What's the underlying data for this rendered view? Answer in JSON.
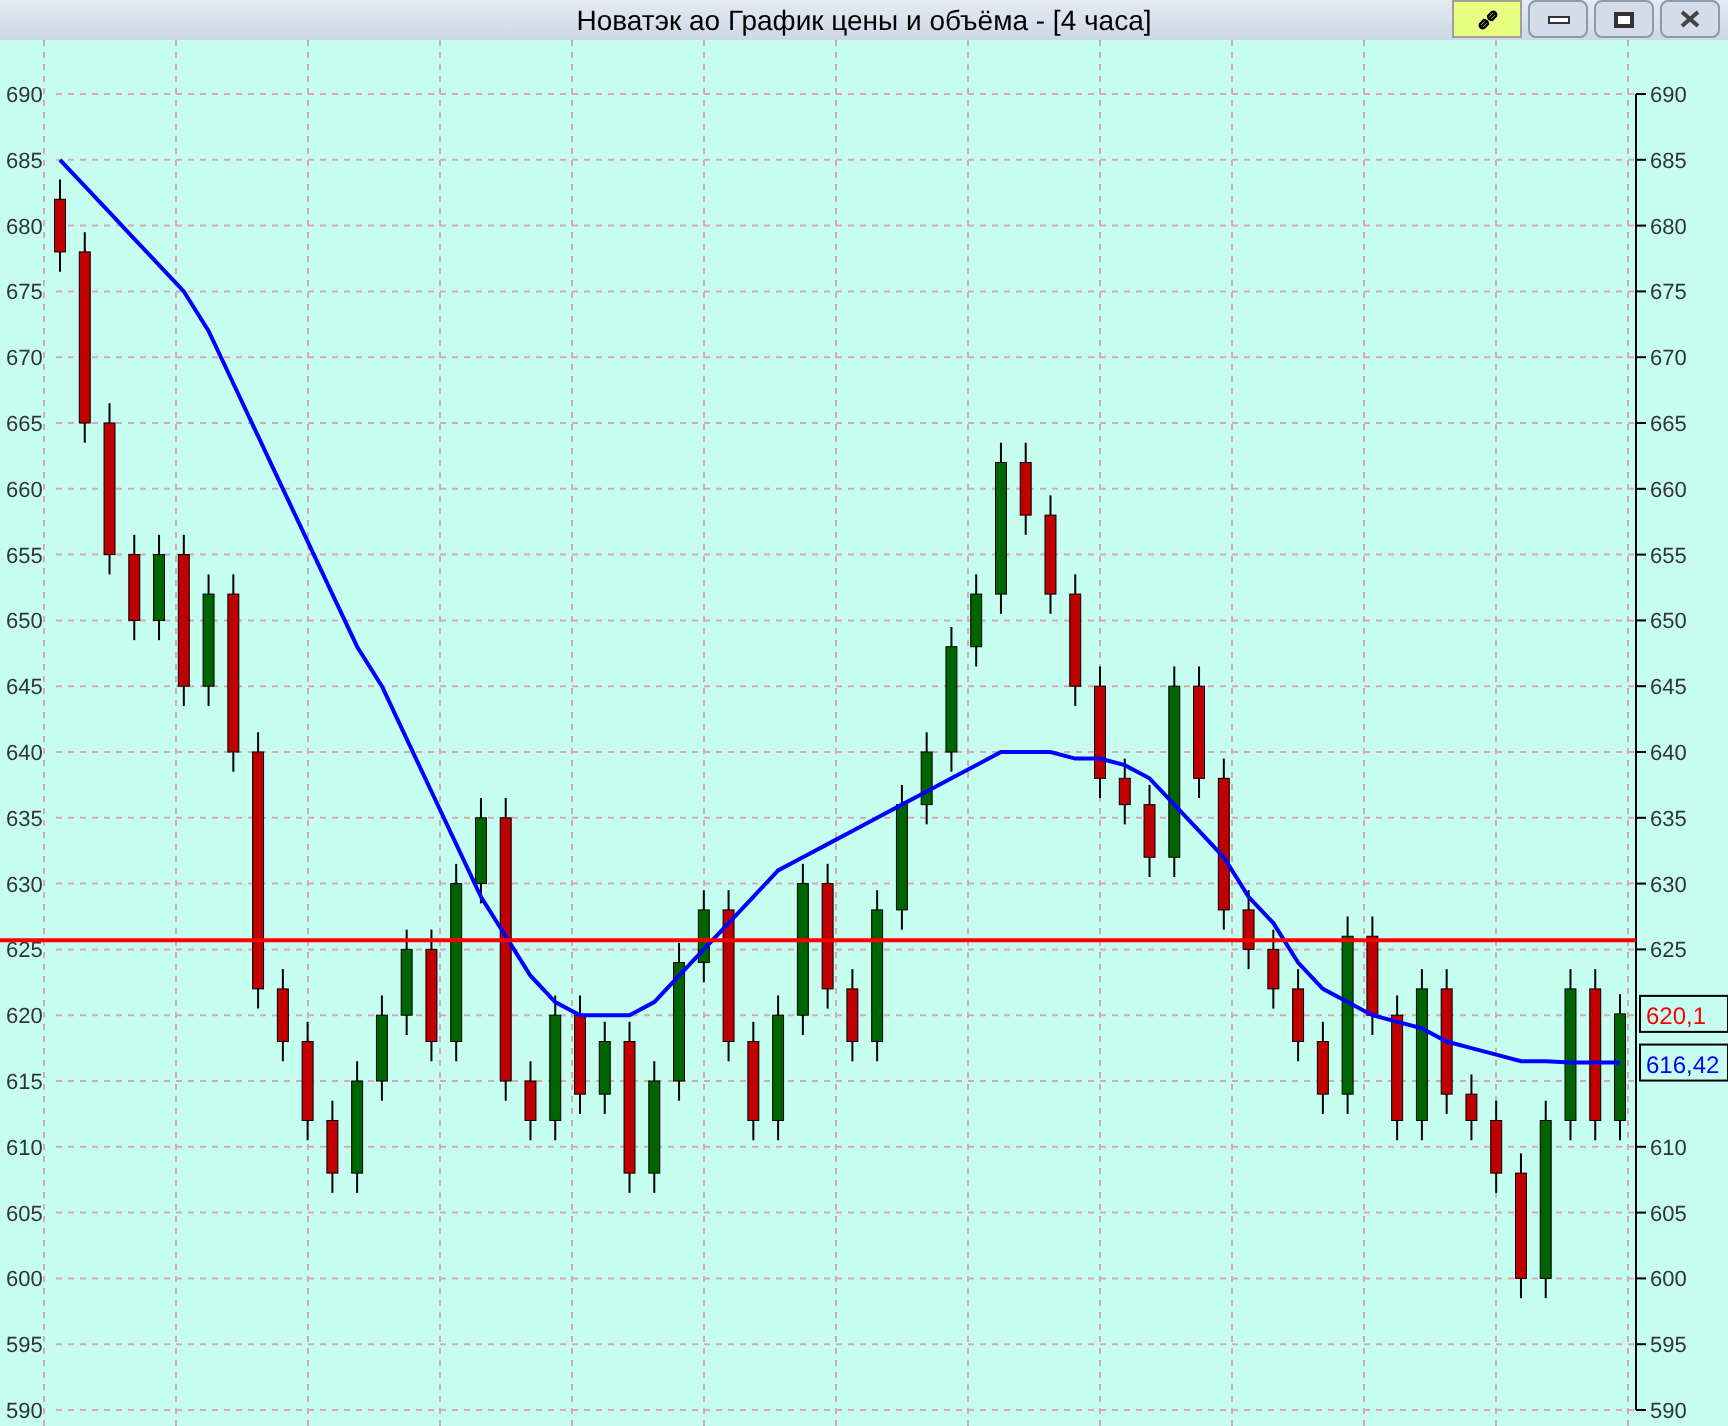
{
  "window": {
    "title": "Новатэк ао График цены и объёма - [4 часа]"
  },
  "chart": {
    "chart_data": {
      "type": "candlestick",
      "grid": true,
      "ylim": [
        590,
        690
      ],
      "yticks": [
        590,
        595,
        600,
        605,
        610,
        615,
        620,
        625,
        630,
        635,
        640,
        645,
        650,
        655,
        660,
        665,
        670,
        675,
        680,
        685,
        690
      ],
      "y2lim": [
        590,
        690
      ],
      "y2ticks": [
        590,
        595,
        600,
        605,
        610,
        625,
        630,
        635,
        640,
        645,
        650,
        655,
        660,
        665,
        670,
        675,
        680,
        685,
        690
      ],
      "ohlc": [
        [
          682,
          683.5,
          676.5,
          678
        ],
        [
          678,
          679.5,
          663.5,
          665
        ],
        [
          665,
          666.5,
          653.5,
          655
        ],
        [
          655,
          656.5,
          648.5,
          650
        ],
        [
          650,
          656.5,
          648.5,
          655
        ],
        [
          655,
          656.5,
          643.5,
          645
        ],
        [
          645,
          653.5,
          643.5,
          652
        ],
        [
          652,
          653.5,
          638.5,
          640
        ],
        [
          640,
          641.5,
          620.5,
          622
        ],
        [
          622,
          623.5,
          616.5,
          618
        ],
        [
          618,
          619.5,
          610.5,
          612
        ],
        [
          612,
          613.5,
          606.5,
          608
        ],
        [
          608,
          616.5,
          606.5,
          615
        ],
        [
          615,
          621.5,
          613.5,
          620
        ],
        [
          620,
          626.5,
          618.5,
          625
        ],
        [
          625,
          626.5,
          616.5,
          618
        ],
        [
          618,
          631.5,
          616.5,
          630
        ],
        [
          630,
          636.5,
          628.5,
          635
        ],
        [
          635,
          636.5,
          613.5,
          615
        ],
        [
          615,
          616.5,
          610.5,
          612
        ],
        [
          612,
          621.5,
          610.5,
          620
        ],
        [
          620,
          621.5,
          612.5,
          614
        ],
        [
          614,
          619.5,
          612.5,
          618
        ],
        [
          618,
          619.5,
          606.5,
          608
        ],
        [
          608,
          616.5,
          606.5,
          615
        ],
        [
          615,
          625.5,
          613.5,
          624
        ],
        [
          624,
          629.5,
          622.5,
          628
        ],
        [
          628,
          629.5,
          616.5,
          618
        ],
        [
          618,
          619.5,
          610.5,
          612
        ],
        [
          612,
          621.5,
          610.5,
          620
        ],
        [
          620,
          631.5,
          618.5,
          630
        ],
        [
          630,
          631.5,
          620.5,
          622
        ],
        [
          622,
          623.5,
          616.5,
          618
        ],
        [
          618,
          629.5,
          616.5,
          628
        ],
        [
          628,
          637.5,
          626.5,
          636
        ],
        [
          636,
          641.5,
          634.5,
          640
        ],
        [
          640,
          649.5,
          638.5,
          648
        ],
        [
          648,
          653.5,
          646.5,
          652
        ],
        [
          652,
          663.5,
          650.5,
          662
        ],
        [
          662,
          663.5,
          656.5,
          658
        ],
        [
          658,
          659.5,
          650.5,
          652
        ],
        [
          652,
          653.5,
          643.5,
          645
        ],
        [
          645,
          646.5,
          636.5,
          638
        ],
        [
          638,
          639.5,
          634.5,
          636
        ],
        [
          636,
          637.5,
          630.5,
          632
        ],
        [
          632,
          646.5,
          630.5,
          645
        ],
        [
          645,
          646.5,
          636.5,
          638
        ],
        [
          638,
          639.5,
          626.5,
          628
        ],
        [
          628,
          629.5,
          623.5,
          625
        ],
        [
          625,
          626.5,
          620.5,
          622
        ],
        [
          622,
          623.5,
          616.5,
          618
        ],
        [
          618,
          619.5,
          612.5,
          614
        ],
        [
          614,
          627.5,
          612.5,
          626
        ],
        [
          626,
          627.5,
          618.5,
          620
        ],
        [
          620,
          621.5,
          610.5,
          612
        ],
        [
          612,
          623.5,
          610.5,
          622
        ],
        [
          622,
          623.5,
          612.5,
          614
        ],
        [
          614,
          615.5,
          610.5,
          612
        ],
        [
          612,
          613.5,
          606.5,
          608
        ],
        [
          608,
          609.5,
          598.5,
          600
        ],
        [
          600,
          613.5,
          598.5,
          612
        ],
        [
          612,
          623.5,
          610.5,
          622
        ],
        [
          622,
          623.5,
          610.5,
          612
        ],
        [
          612,
          621.6,
          610.5,
          620.1
        ]
      ],
      "series": [
        {
          "type": "line",
          "color": "#0000ff",
          "values": [
            685,
            683,
            681,
            679,
            677,
            675,
            672,
            668,
            664,
            660,
            656,
            652,
            648,
            645,
            641,
            637,
            633,
            629,
            626,
            623,
            621,
            620,
            620,
            620,
            621,
            623,
            625,
            627,
            629,
            631,
            632,
            633,
            634,
            635,
            636,
            637,
            638,
            639,
            640,
            640,
            640,
            639.5,
            639.5,
            639,
            638,
            636,
            634,
            632,
            629,
            627,
            624,
            622,
            621,
            620,
            619.5,
            619,
            618,
            617.5,
            617,
            616.5,
            616.5,
            616.4,
            616.4,
            616.4
          ]
        }
      ],
      "ref_lines": [
        {
          "axis": "y",
          "value": 625.7,
          "color": "#ff0000"
        }
      ],
      "annotations": [
        "620,1",
        "616,42"
      ]
    }
  }
}
